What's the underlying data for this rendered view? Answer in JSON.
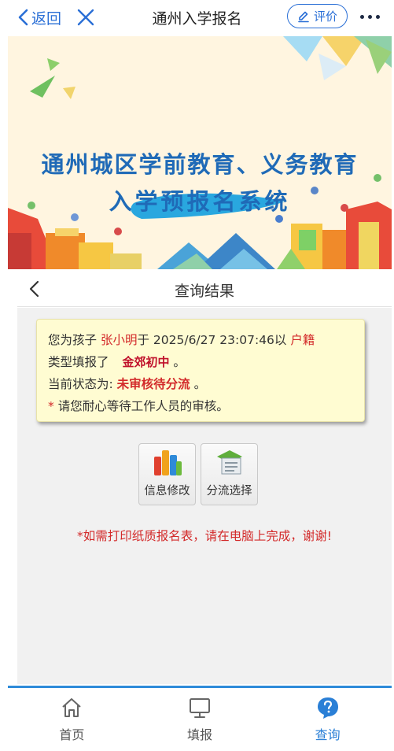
{
  "nav": {
    "back_label": "返回",
    "title": "通州入学报名",
    "rate_label": "评价"
  },
  "banner": {
    "line1": "通州城区学前教育、义务教育",
    "line2": "入学预报名系统"
  },
  "subheader": {
    "title": "查询结果"
  },
  "notice": {
    "p1_prefix": "您为孩子",
    "child_name": "张小明",
    "p1_mid": "于 2025/6/27 23:07:46以",
    "type_value": "户籍",
    "p2_prefix": "类型填报了",
    "school_stamp": "金郊初中",
    "p2_suffix": "。",
    "p3_prefix": "当前状态为:",
    "status_value": "未审核待分流",
    "p3_suffix": "。",
    "p4_star": "*",
    "p4_text": "请您耐心等待工作人员的审核。"
  },
  "actions": [
    {
      "label": "信息修改",
      "icon": "bar-chart-icon"
    },
    {
      "label": "分流选择",
      "icon": "document-stack-icon"
    }
  ],
  "print_tip": "*如需打印纸质报名表，请在电脑上完成，谢谢!",
  "tabs": [
    {
      "label": "首页",
      "icon": "home-icon",
      "active": false
    },
    {
      "label": "填报",
      "icon": "monitor-icon",
      "active": false
    },
    {
      "label": "查询",
      "icon": "question-icon",
      "active": true
    }
  ],
  "colors": {
    "accent": "#2a6fd6",
    "banner_text": "#1f6ab7",
    "highlight_red": "#d32b2b",
    "notice_bg": "#fffcd2",
    "tabbar_border": "#2e8bd9"
  }
}
